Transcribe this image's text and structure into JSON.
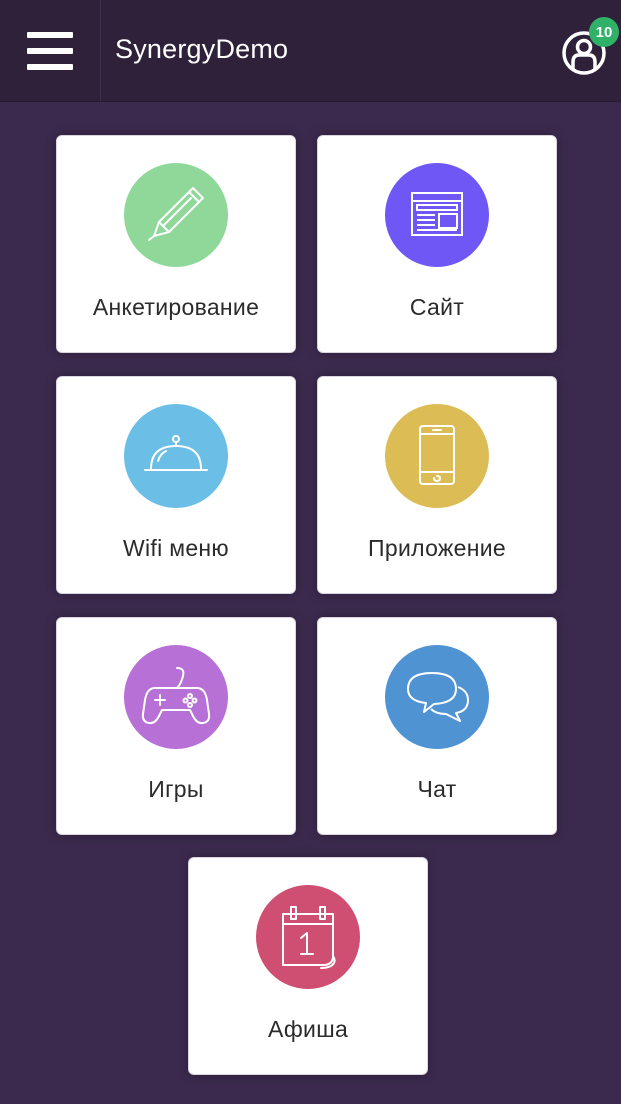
{
  "header": {
    "title": "SynergyDemo",
    "menu_icon": "hamburger-menu-icon",
    "profile_icon": "user-profile-icon",
    "notification_count": "10"
  },
  "colors": {
    "background": "#3b2a4d",
    "header": "#2e2139",
    "badge": "#2fb168"
  },
  "tiles": [
    {
      "label": "Анкетирование",
      "icon": "pencil-icon",
      "color": "#8fd89a"
    },
    {
      "label": "Сайт",
      "icon": "website-layout-icon",
      "color": "#6f57f5"
    },
    {
      "label": "Wifi меню",
      "icon": "food-cloche-icon",
      "color": "#6bbfe6"
    },
    {
      "label": "Приложение",
      "icon": "smartphone-icon",
      "color": "#dcbd55"
    },
    {
      "label": "Игры",
      "icon": "gamepad-icon",
      "color": "#b770d6"
    },
    {
      "label": "Чат",
      "icon": "chat-bubbles-icon",
      "color": "#4f93d3"
    },
    {
      "label": "Афиша",
      "icon": "calendar-icon",
      "color": "#cf4f73"
    }
  ]
}
